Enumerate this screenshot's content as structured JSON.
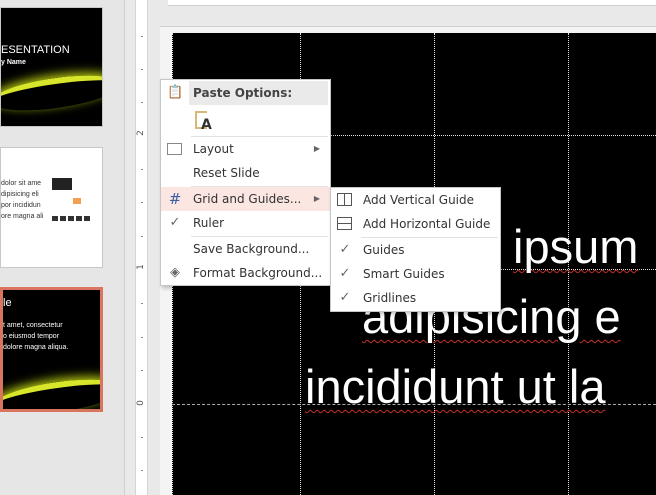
{
  "thumbnails": [
    {
      "title": "ESENTATION",
      "subtitle": "y Name"
    },
    {
      "lines": [
        "dolor sit ame",
        "dipisicing eli",
        "por incididun",
        "ore magna ali"
      ]
    },
    {
      "title": "le",
      "lines": [
        "t amet, consectetur",
        "o eiusmod tempor",
        "dolore magna aliqua."
      ],
      "selected": true
    }
  ],
  "ruler": {
    "labels": [
      "2",
      "1",
      "0"
    ]
  },
  "slide": {
    "lines": [
      "ipsum",
      "adipisicing e",
      "incididunt ut la"
    ]
  },
  "context_menu": {
    "paste_header": "Paste Options:",
    "paste_option_icon": "keep-text-only-icon",
    "items": [
      {
        "label": "Layout",
        "icon": "layout-icon",
        "submenu": true
      },
      {
        "label": "Reset Slide"
      },
      {
        "label": "Grid and Guides...",
        "icon": "grid-icon",
        "submenu": true,
        "highlighted": true
      },
      {
        "label": "Ruler",
        "checked": true
      },
      {
        "label": "Save Background..."
      },
      {
        "label": "Format Background...",
        "icon": "format-background-icon"
      }
    ]
  },
  "submenu": {
    "items": [
      {
        "label": "Add Vertical Guide",
        "icon": "vertical-guide-icon"
      },
      {
        "label": "Add Horizontal Guide",
        "icon": "horizontal-guide-icon"
      },
      {
        "label": "Guides",
        "checked": true
      },
      {
        "label": "Smart Guides",
        "checked": true
      },
      {
        "label": "Gridlines",
        "checked": true
      }
    ]
  },
  "colors": {
    "selection_border": "#d9745f",
    "highlight": "#fbe6e1",
    "accent_swoosh": "#d7e62a"
  }
}
